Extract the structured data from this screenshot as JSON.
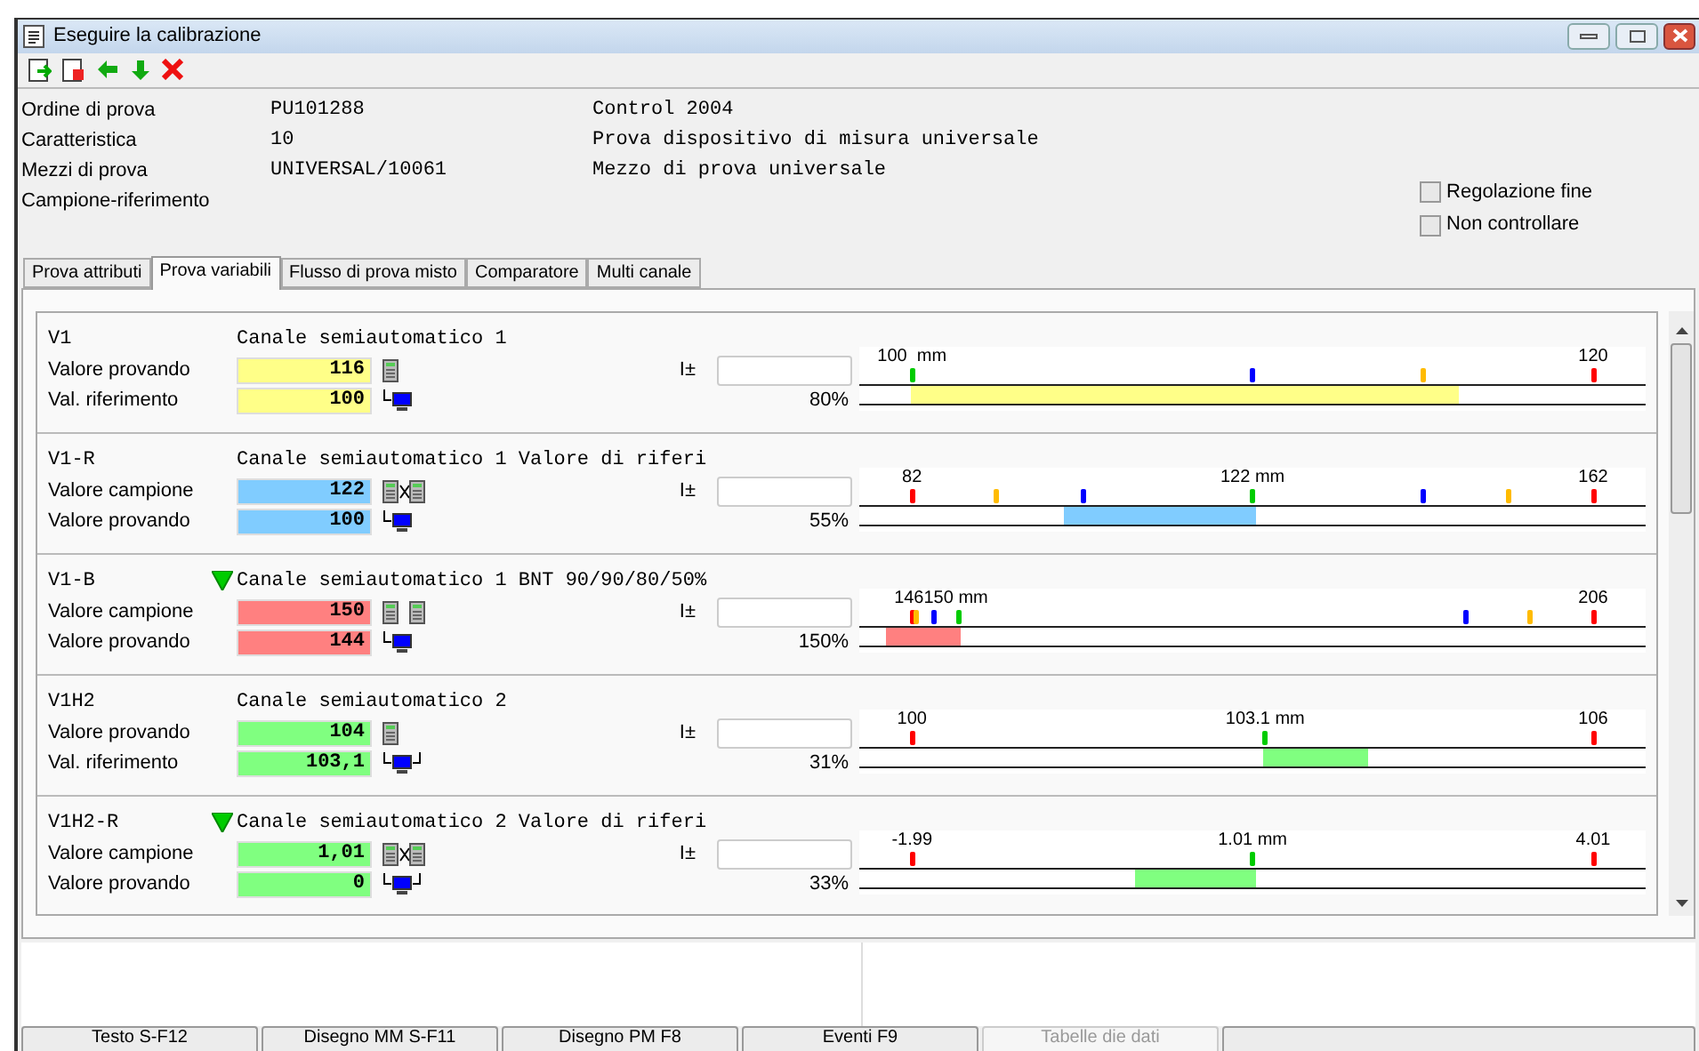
{
  "window": {
    "title": "Eseguire la calibrazione"
  },
  "header": [
    {
      "label": "Ordine di prova",
      "value": "PU101288",
      "description": "Control 2004"
    },
    {
      "label": "Caratteristica",
      "value": "10",
      "description": "Prova dispositivo di misura universale"
    },
    {
      "label": "Mezzi di prova",
      "value": "UNIVERSAL/10061",
      "description": "Mezzo di prova universale"
    },
    {
      "label": "Campione-riferimento"
    }
  ],
  "options": [
    {
      "label": "Regolazione fine",
      "checked": false
    },
    {
      "label": "Non controllare",
      "checked": false
    }
  ],
  "tabs": [
    {
      "label": "Prova attributi",
      "selected": false
    },
    {
      "label": "Prova variabili",
      "selected": true
    },
    {
      "label": "Flusso di prova misto",
      "selected": false
    },
    {
      "label": "Comparatore",
      "selected": false
    },
    {
      "label": "Multi canale",
      "selected": false
    }
  ],
  "channels": [
    {
      "id": "V1",
      "warning": false,
      "name": "Canale semiautomatico 1",
      "color": "#ffff88",
      "tolerance_label": "I±",
      "percent": "80%",
      "lines": [
        {
          "label": "Valore provando",
          "value": "116",
          "kind": "device"
        },
        {
          "label": "Val. riferimento",
          "value": "100",
          "kind": "computer"
        }
      ],
      "gauge": {
        "labels": [
          {
            "text": "100  mm",
            "level": 0.067
          },
          {
            "text": "120",
            "level": 0.933
          }
        ],
        "markers": [
          {
            "color": "#00cc00",
            "level": 0.067
          },
          {
            "color": "#0000ff",
            "level": 0.5
          },
          {
            "color": "#ffbb00",
            "level": 0.718
          },
          {
            "color": "#ff0000",
            "level": 0.933
          }
        ],
        "bar": {
          "start": {
            "level": 0.067
          },
          "end": {
            "level": 0.76
          }
        }
      }
    },
    {
      "id": "V1-R",
      "warning": false,
      "name": "Canale semiautomatico 1 Valore di riferi",
      "color": "#80ccff",
      "tolerance_label": "I±",
      "percent": "55%",
      "lines": [
        {
          "label": "Valore campione",
          "value": "122",
          "kind": "compare"
        },
        {
          "label": "Valore provando",
          "value": "100",
          "kind": "computer"
        }
      ],
      "gauge": {
        "labels": [
          {
            "text": "82",
            "level": 0.067
          },
          {
            "text": "122 mm",
            "level": 0.5
          },
          {
            "text": "162",
            "level": 0.933
          }
        ],
        "markers": [
          {
            "color": "#ff0000",
            "level": 0.067
          },
          {
            "color": "#ffbb00",
            "level": 0.175
          },
          {
            "color": "#0000ff",
            "level": 0.284
          },
          {
            "color": "#00cc00",
            "level": 0.5
          },
          {
            "color": "#0000ff",
            "level": 0.718
          },
          {
            "color": "#ffbb00",
            "level": 0.826
          },
          {
            "color": "#ff0000",
            "level": 0.933
          }
        ],
        "bar": {
          "start": {
            "level": 0.262
          },
          "end": {
            "level": 0.502
          }
        }
      }
    },
    {
      "id": "V1-B",
      "warning": true,
      "name": "Canale semiautomatico 1 BNT 90/90/80/50%",
      "color": "#ff8080",
      "tolerance_label": "I±",
      "percent": "150%",
      "lines": [
        {
          "label": "Valore campione",
          "value": "150",
          "kind": "device-pair"
        },
        {
          "label": "Valore provando",
          "value": "144",
          "kind": "computer"
        }
      ],
      "gauge": {
        "labels": [
          {
            "text": "146150 mm",
            "level": 0.104
          },
          {
            "text": "206",
            "level": 0.933
          }
        ],
        "markers": [
          {
            "color": "#ff0000",
            "level": 0.067
          },
          {
            "color": "#ffbb00",
            "level": 0.073
          },
          {
            "color": "#0000ff",
            "level": 0.096
          },
          {
            "color": "#00cc00",
            "level": 0.127
          },
          {
            "color": "#0000ff",
            "level": 0.771
          },
          {
            "color": "#ffbb00",
            "level": 0.853
          },
          {
            "color": "#ff0000",
            "level": 0.933
          }
        ],
        "bar": {
          "start": {
            "level": 0.036
          },
          "end": {
            "level": 0.127
          }
        }
      }
    },
    {
      "id": "V1H2",
      "warning": false,
      "name": "Canale semiautomatico 2",
      "color": "#80ff80",
      "tolerance_label": "I±",
      "percent": "31%",
      "lines": [
        {
          "label": "Valore provando",
          "value": "104",
          "kind": "device"
        },
        {
          "label": "Val. riferimento",
          "value": "103,1",
          "kind": "computer-linked"
        }
      ],
      "gauge": {
        "labels": [
          {
            "text": "100",
            "level": 0.067
          },
          {
            "text": "103.1 mm",
            "level": 0.516
          },
          {
            "text": "106",
            "level": 0.933
          }
        ],
        "markers": [
          {
            "color": "#ff0000",
            "level": 0.067
          },
          {
            "color": "#00cc00",
            "level": 0.516
          },
          {
            "color": "#ff0000",
            "level": 0.933
          }
        ],
        "bar": {
          "start": {
            "level": 0.516
          },
          "end": {
            "level": 0.644
          }
        }
      }
    },
    {
      "id": "V1H2-R",
      "warning": true,
      "name": "Canale semiautomatico 2 Valore di riferi",
      "color": "#80ff80",
      "tolerance_label": "I±",
      "percent": "33%",
      "lines": [
        {
          "label": "Valore campione",
          "value": "1,01",
          "kind": "compare"
        },
        {
          "label": "Valore provando",
          "value": "0",
          "kind": "computer-linked"
        }
      ],
      "gauge": {
        "labels": [
          {
            "text": "-1.99",
            "level": 0.067
          },
          {
            "text": "1.01 mm",
            "level": 0.5
          },
          {
            "text": "4.01",
            "level": 0.933
          }
        ],
        "markers": [
          {
            "color": "#ff0000",
            "level": 0.067
          },
          {
            "color": "#00cc00",
            "level": 0.5
          },
          {
            "color": "#ff0000",
            "level": 0.933
          }
        ],
        "bar": {
          "start": {
            "level": 0.353
          },
          "end": {
            "level": 0.502
          }
        }
      }
    }
  ],
  "bottom_buttons": [
    {
      "label": "Testo S-F12",
      "disabled": false
    },
    {
      "label": "Disegno MM S-F11",
      "disabled": false
    },
    {
      "label": "Disegno PM F8",
      "disabled": false
    },
    {
      "label": "Eventi F9",
      "disabled": false
    },
    {
      "label": "Tabelle die dati",
      "disabled": true
    },
    {
      "disabled": false
    }
  ]
}
